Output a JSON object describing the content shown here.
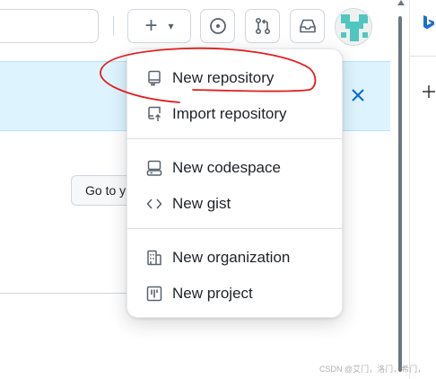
{
  "header": {
    "create_label": "+",
    "create_caret": "▾"
  },
  "page": {
    "goto_button_label": "Go to y"
  },
  "menu": {
    "items": [
      {
        "label": "New repository",
        "icon": "repo-icon"
      },
      {
        "label": "Import repository",
        "icon": "repo-push-icon"
      },
      {
        "label": "New codespace",
        "icon": "codespaces-icon"
      },
      {
        "label": "New gist",
        "icon": "code-icon"
      },
      {
        "label": "New organization",
        "icon": "organization-icon"
      },
      {
        "label": "New project",
        "icon": "project-icon"
      }
    ]
  },
  "watermark": "CSDN @艾门，洛门，希门，",
  "colors": {
    "banner_bg": "#ddf4ff",
    "accent_blue": "#0969da",
    "annotation_red": "#e02020",
    "avatar_teal": "#4fc7c0"
  }
}
